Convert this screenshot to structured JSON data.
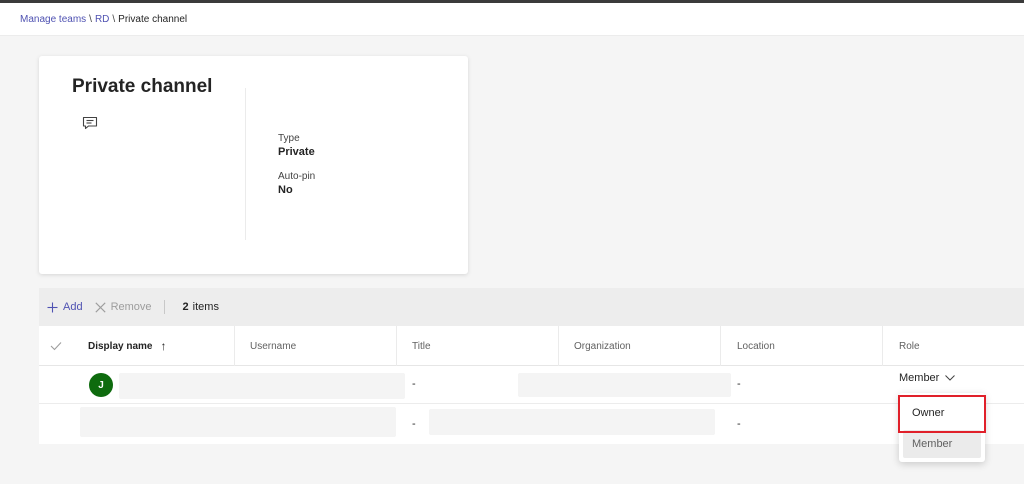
{
  "breadcrumb": {
    "items": [
      "Manage teams",
      "RD"
    ],
    "separator": "\\",
    "current": "Private channel"
  },
  "channel_card": {
    "title": "Private channel",
    "type_label": "Type",
    "type_value": "Private",
    "autopin_label": "Auto-pin",
    "autopin_value": "No",
    "icon": "chat-icon"
  },
  "toolbar": {
    "add_label": "Add",
    "remove_label": "Remove",
    "item_count": "2",
    "items_label": "items"
  },
  "table": {
    "columns": [
      "Display name",
      "Username",
      "Title",
      "Organization",
      "Location",
      "Role"
    ],
    "sort_indicator": "↑",
    "rows": [
      {
        "avatar_initial": "J",
        "title": "-",
        "location": "-",
        "role": "Member"
      },
      {
        "title": "-",
        "location": "-"
      }
    ]
  },
  "role_dropdown": {
    "options": [
      "Owner",
      "Member"
    ],
    "highlighted": "Owner",
    "selected": "Member"
  },
  "colors": {
    "accent": "#4f52b2",
    "avatar": "#0e6b0e",
    "highlight_border": "#e0202a"
  }
}
